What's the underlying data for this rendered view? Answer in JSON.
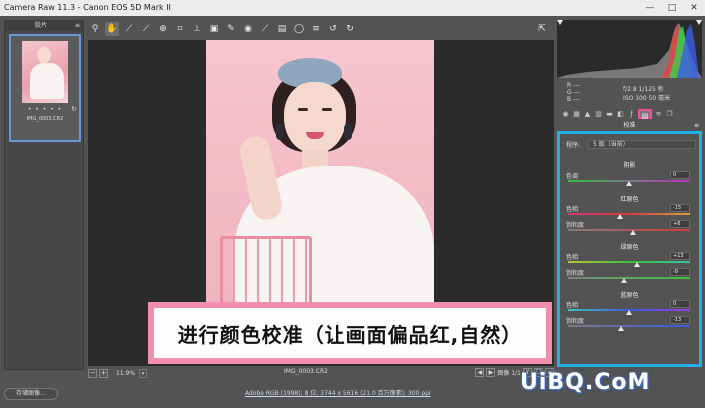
{
  "window": {
    "title": "Camera Raw 11.3 -  Canon EOS 5D Mark II",
    "controls": [
      "—",
      "□",
      "✕"
    ]
  },
  "filmstrip": {
    "header": "胶片",
    "menu": "≡",
    "thumb_stars": "• • • • •",
    "thumb_filename": "IMG_0003.CR2"
  },
  "toolbar": {
    "tools": [
      "zoom-icon",
      "hand-icon",
      "white-balance-icon",
      "color-sampler-icon",
      "target-adjust-icon",
      "crop-icon",
      "straighten-icon",
      "transform-icon",
      "spot-removal-icon",
      "red-eye-icon",
      "adjustment-brush-icon",
      "graduated-filter-icon",
      "radial-filter-icon",
      "rotate-left-icon",
      "rotate-right-icon"
    ],
    "exit_icon": "fullscreen-icon"
  },
  "caption": {
    "text": "进行颜色校准（让画面偏品红,自然）"
  },
  "status": {
    "zoom": "11.9%",
    "filename": "IMG_0003.CR2",
    "image_label": "图像 1/1",
    "nav_buttons": [
      "◀",
      "▶"
    ],
    "right_buttons": [
      "Y",
      "☐",
      "≡"
    ]
  },
  "bottom": {
    "save_label": "存储图像...",
    "workflow": "Adobe RGB (1998); 8 位; 3744 x 5616 (21.0 百万像素); 300 ppi"
  },
  "info": {
    "r_label": "R",
    "g_label": "G",
    "b_label": "B",
    "r_value": "---",
    "g_value": "---",
    "b_value": "---",
    "exposure": "f/2.8  1/125 秒",
    "iso": "ISO 100  50 毫米"
  },
  "panel": {
    "title": "校准",
    "menu": "≡",
    "process_label": "程序:",
    "process_value": "5 版（当前）",
    "shadows": {
      "heading": "阴影",
      "tint_label": "色调",
      "tint_value": "0",
      "tint_level": 0
    },
    "red": {
      "heading": "红原色",
      "hue_label": "色相",
      "hue_value": "-15",
      "hue_level": -15,
      "sat_label": "饱和度",
      "sat_value": "+6",
      "sat_level": 6
    },
    "green": {
      "heading": "绿原色",
      "hue_label": "色相",
      "hue_value": "+13",
      "hue_level": 13,
      "sat_label": "饱和度",
      "sat_value": "-9",
      "sat_level": -9
    },
    "blue": {
      "heading": "蓝原色",
      "hue_label": "色相",
      "hue_value": "0",
      "hue_level": 0,
      "sat_label": "饱和度",
      "sat_value": "-13",
      "sat_level": -13
    }
  },
  "watermark": "UiBQ.CoM",
  "colors": {
    "highlight_border": "#1fb0e8",
    "active_tab": "#f0509a",
    "caption_border": "#f08fb0"
  }
}
